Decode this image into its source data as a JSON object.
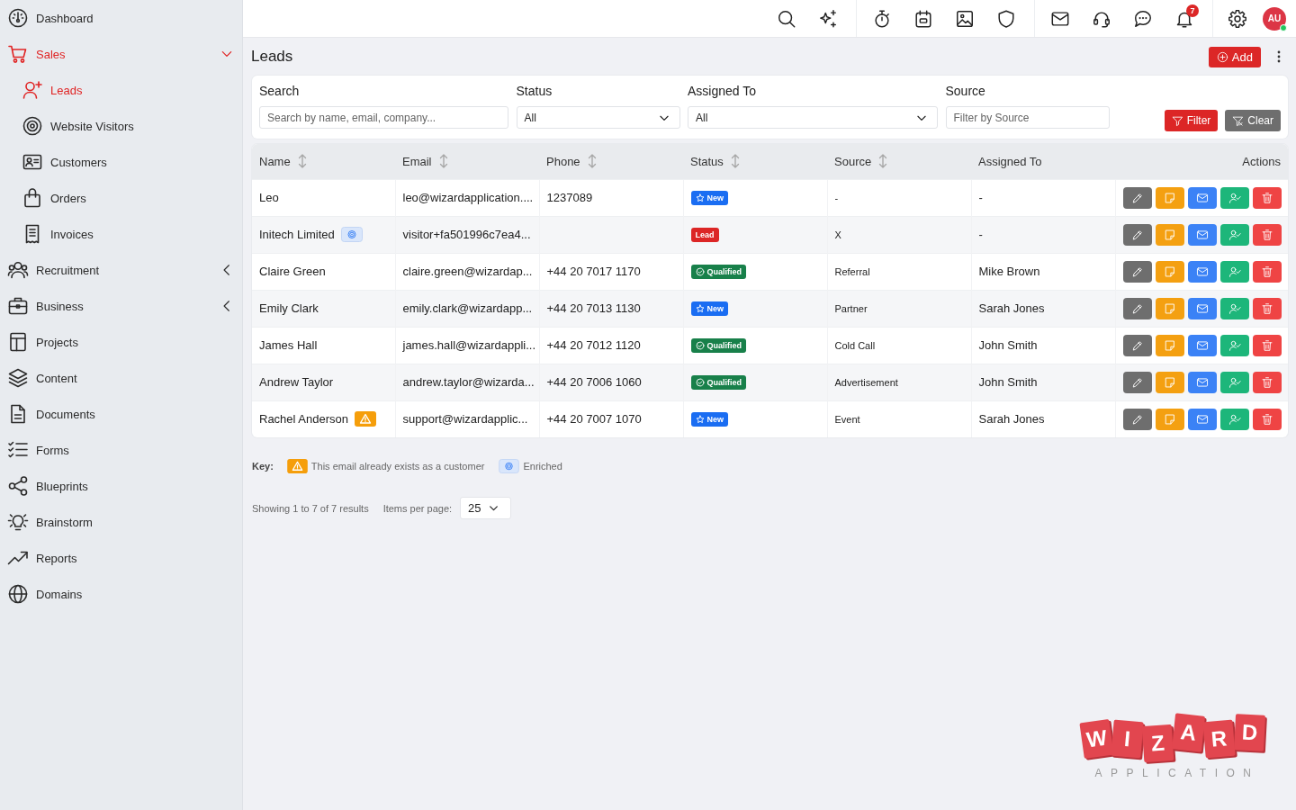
{
  "topbar": {
    "groups": [
      {
        "items": [
          {
            "kind": "search"
          },
          {
            "kind": "sparkle"
          }
        ]
      },
      {
        "items": [
          {
            "kind": "stopwatch"
          },
          {
            "kind": "calendar"
          },
          {
            "kind": "image"
          },
          {
            "kind": "shield"
          }
        ]
      },
      {
        "items": [
          {
            "kind": "mail"
          },
          {
            "kind": "headset"
          },
          {
            "kind": "chat"
          },
          {
            "kind": "bell",
            "badge": "7"
          }
        ]
      },
      {
        "items": [
          {
            "kind": "settings"
          },
          {
            "kind": "avatar",
            "initials": "AU",
            "online": true
          }
        ]
      }
    ]
  },
  "sidebar": {
    "items": [
      {
        "label": "Dashboard",
        "kind": "dashboard",
        "selected": false
      },
      {
        "label": "Sales",
        "kind": "cart",
        "selected": true,
        "expanded": true,
        "children": [
          {
            "label": "Leads",
            "kind": "user-plus",
            "selected": true
          },
          {
            "label": "Website Visitors",
            "kind": "target",
            "selected": false
          },
          {
            "label": "Customers",
            "kind": "id-card",
            "selected": false
          },
          {
            "label": "Orders",
            "kind": "bag",
            "selected": false
          },
          {
            "label": "Invoices",
            "kind": "receipt",
            "selected": false
          }
        ]
      },
      {
        "label": "Recruitment",
        "kind": "users",
        "selected": false,
        "expanded": false
      },
      {
        "label": "Business",
        "kind": "briefcase",
        "selected": false,
        "expanded": false
      },
      {
        "label": "Projects",
        "kind": "layout",
        "selected": false
      },
      {
        "label": "Content",
        "kind": "layers",
        "selected": false
      },
      {
        "label": "Documents",
        "kind": "file",
        "selected": false
      },
      {
        "label": "Forms",
        "kind": "checklist",
        "selected": false
      },
      {
        "label": "Blueprints",
        "kind": "share",
        "selected": false
      },
      {
        "label": "Brainstorm",
        "kind": "bulb",
        "selected": false
      },
      {
        "label": "Reports",
        "kind": "trend",
        "selected": false
      },
      {
        "label": "Domains",
        "kind": "globe",
        "selected": false
      }
    ]
  },
  "page": {
    "title": "Leads",
    "add_button": "Add"
  },
  "filters": {
    "fields": [
      {
        "label": "Search",
        "kind": "text",
        "placeholder": "Search by name, email, company..."
      },
      {
        "label": "Status",
        "kind": "select",
        "value": "All"
      },
      {
        "label": "Assigned To",
        "kind": "select",
        "value": "All"
      },
      {
        "label": "Source",
        "kind": "text",
        "placeholder": "Filter by Source"
      }
    ],
    "buttons": [
      {
        "label": "Filter",
        "kind": "filter"
      },
      {
        "label": "Clear",
        "kind": "clear"
      }
    ]
  },
  "table": {
    "columns": [
      {
        "label": "Name",
        "sortable": true
      },
      {
        "label": "Email",
        "sortable": true
      },
      {
        "label": "Phone",
        "sortable": true
      },
      {
        "label": "Status",
        "sortable": true
      },
      {
        "label": "Source",
        "sortable": true
      },
      {
        "label": "Assigned To",
        "sortable": false
      },
      {
        "label": "Actions",
        "sortable": false
      }
    ],
    "row_actions": [
      {
        "kind": "edit"
      },
      {
        "kind": "note"
      },
      {
        "kind": "email"
      },
      {
        "kind": "assign"
      },
      {
        "kind": "delete"
      }
    ],
    "rows": [
      {
        "name": "Leo",
        "email": "leo@wizardapplication....",
        "phone": "1237089",
        "status": {
          "label": "New",
          "kind": "new"
        },
        "source": "-",
        "assigned_to": "-"
      },
      {
        "name": "Initech Limited",
        "marker": {
          "kind": "enriched"
        },
        "email": "visitor+fa501996c7ea4...",
        "status": {
          "label": "Lead",
          "kind": "lead"
        },
        "source": "X",
        "assigned_to": "-"
      },
      {
        "name": "Claire Green",
        "email": "claire.green@wizardap...",
        "phone": "+44 20 7017 1170",
        "status": {
          "label": "Qualified",
          "kind": "qualified"
        },
        "source": "Referral",
        "assigned_to": "Mike Brown"
      },
      {
        "name": "Emily Clark",
        "email": "emily.clark@wizardapp...",
        "phone": "+44 20 7013 1130",
        "status": {
          "label": "New",
          "kind": "new"
        },
        "source": "Partner",
        "assigned_to": "Sarah Jones"
      },
      {
        "name": "James Hall",
        "email": "james.hall@wizardappli...",
        "phone": "+44 20 7012 1120",
        "status": {
          "label": "Qualified",
          "kind": "qualified"
        },
        "source": "Cold Call",
        "assigned_to": "John Smith"
      },
      {
        "name": "Andrew Taylor",
        "email": "andrew.taylor@wizarda...",
        "phone": "+44 20 7006 1060",
        "status": {
          "label": "Qualified",
          "kind": "qualified"
        },
        "source": "Advertisement",
        "assigned_to": "John Smith"
      },
      {
        "name": "Rachel Anderson",
        "marker": {
          "kind": "warning"
        },
        "email": "support@wizardapplic...",
        "phone": "+44 20 7007 1070",
        "status": {
          "label": "New",
          "kind": "new"
        },
        "source": "Event",
        "assigned_to": "Sarah Jones"
      }
    ]
  },
  "legend": {
    "label": "Key:",
    "items": [
      {
        "kind": "warning",
        "label": "This email already exists as a customer"
      },
      {
        "kind": "enriched",
        "label": "Enriched"
      }
    ]
  },
  "pagination": {
    "summary": "Showing 1 to 7 of 7 results",
    "per_page_label": "Items per page:",
    "per_page": "25"
  },
  "logo": {
    "letters": [
      "W",
      "I",
      "Z",
      "A",
      "R",
      "D"
    ],
    "tagline": "APPLICATION"
  }
}
